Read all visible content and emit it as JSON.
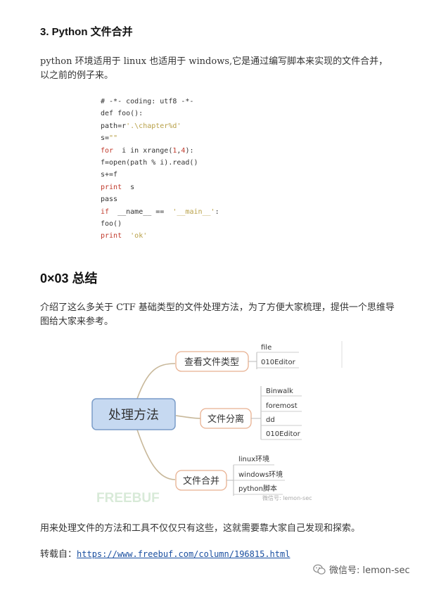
{
  "section3": {
    "heading": "3. Python 文件合并"
  },
  "para1": "python 环境适用于 linux 也适用于 windows,它是通过编写脚本来实现的文件合并，以之前的例子来。",
  "code": {
    "l1": "# -*- coding: utf8 -*-",
    "l2": "def foo():",
    "l3_pre": "path=r",
    "l3_str": "'.\\chapter%d'",
    "l4_pre": "s=",
    "l4_str": "\"\"",
    "l5_kw": "for",
    "l5_a": "  i in xrange(",
    "l5_n1": "1",
    "l5_b": ",",
    "l5_n2": "4",
    "l5_c": "):",
    "l6": "f=open(path % i).read()",
    "l7": "s+=f",
    "l8_kw": "print",
    "l8_rest": "  s",
    "l9": "pass",
    "l10_kw": "if",
    "l10_a": "  __name__ ==  ",
    "l10_str": "'__main__'",
    "l10_b": ":",
    "l11": "foo()",
    "l12_kw": "print",
    "l12_str": "  'ok'"
  },
  "summary": {
    "heading": "0×03  总结"
  },
  "para2": "介绍了这么多关于 CTF 基础类型的文件处理方法，为了方便大家梳理，提供一个思维导图给大家来参考。",
  "mindmap": {
    "root": "处理方法",
    "branches": [
      {
        "label": "查看文件类型",
        "leaves": [
          "file",
          "010Editor"
        ]
      },
      {
        "label": "文件分离",
        "leaves": [
          "Binwalk",
          "foremost",
          "dd",
          "010Editor"
        ]
      },
      {
        "label": "文件合并",
        "leaves": [
          "linux环境",
          "windows环境",
          "python脚本"
        ]
      }
    ],
    "watermark_logo": "FREEBUF",
    "watermark_small": "微信号: lemon-sec",
    "colors": {
      "root_fill": "#c6d9f1",
      "root_stroke": "#7a9cc8",
      "branch_stroke": "#e8b090",
      "line": "#c8b89a",
      "leaf_line": "#b8b8b8"
    }
  },
  "para3": "用来处理文件的方法和工具不仅仅只有这些，这就需要靠大家自己发现和探索。",
  "source": {
    "label": "转载自：",
    "url": "https://www.freebuf.com/column/196815.html"
  },
  "footer": {
    "wechat_icon": "wechat-icon",
    "text": "微信号: lemon-sec"
  }
}
